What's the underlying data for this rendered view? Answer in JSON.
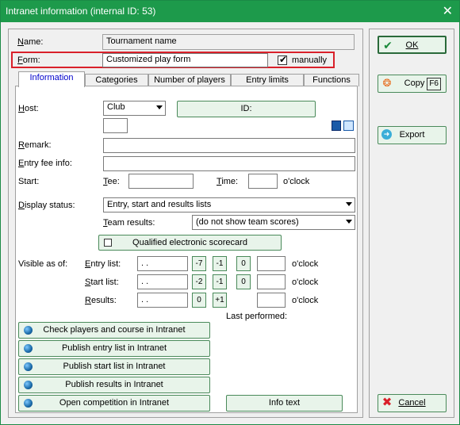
{
  "window": {
    "title": "Intranet information (internal ID: 53)",
    "close_glyph": "✕"
  },
  "name": {
    "label": "Name:",
    "value": "Tournament name"
  },
  "form": {
    "label": "Form:",
    "value": "Customized play form",
    "manual_label": "manually",
    "manual_checked": true
  },
  "tabs": [
    "Information",
    "Categories",
    "Number of players",
    "Entry limits",
    "Functions"
  ],
  "host": {
    "label": "Host:",
    "value": "Club",
    "id_button": "ID:"
  },
  "remark": {
    "label": "Remark:",
    "value": ""
  },
  "entry_fee": {
    "label": "Entry fee info:",
    "value": ""
  },
  "start": {
    "label": "Start:",
    "tee_label": "Tee:",
    "time_label": "Time:",
    "oclock": "o'clock"
  },
  "display_status": {
    "label": "Display status:",
    "value": "Entry, start and results lists"
  },
  "team_results": {
    "label": "Team results:",
    "value": "(do not show team scores)"
  },
  "qualified_scorecard": {
    "label": "Qualified electronic scorecard",
    "checked": false
  },
  "visible_as_of": {
    "label": "Visible as of:",
    "rows": [
      {
        "label": "Entry list:",
        "date": " .  .",
        "b1": "-7",
        "b2": "-1",
        "b3": "0",
        "oclock": "o'clock"
      },
      {
        "label": "Start list:",
        "date": " .  .",
        "b1": "-2",
        "b2": "-1",
        "b3": "0",
        "oclock": "o'clock"
      },
      {
        "label": "Results:",
        "date": " .  .",
        "b1": "0",
        "b2": "+1",
        "oclock": "o'clock"
      }
    ],
    "last_performed": "Last performed:"
  },
  "intranet_buttons": [
    "Check players and course in Intranet",
    "Publish entry list in Intranet",
    "Publish start list in Intranet",
    "Publish results in Intranet",
    "Open competition in Intranet"
  ],
  "info_text_button": "Info text",
  "right_buttons": {
    "ok": "OK",
    "copy": "Copy",
    "copy_key": "F6",
    "export": "Export",
    "cancel": "Cancel"
  }
}
